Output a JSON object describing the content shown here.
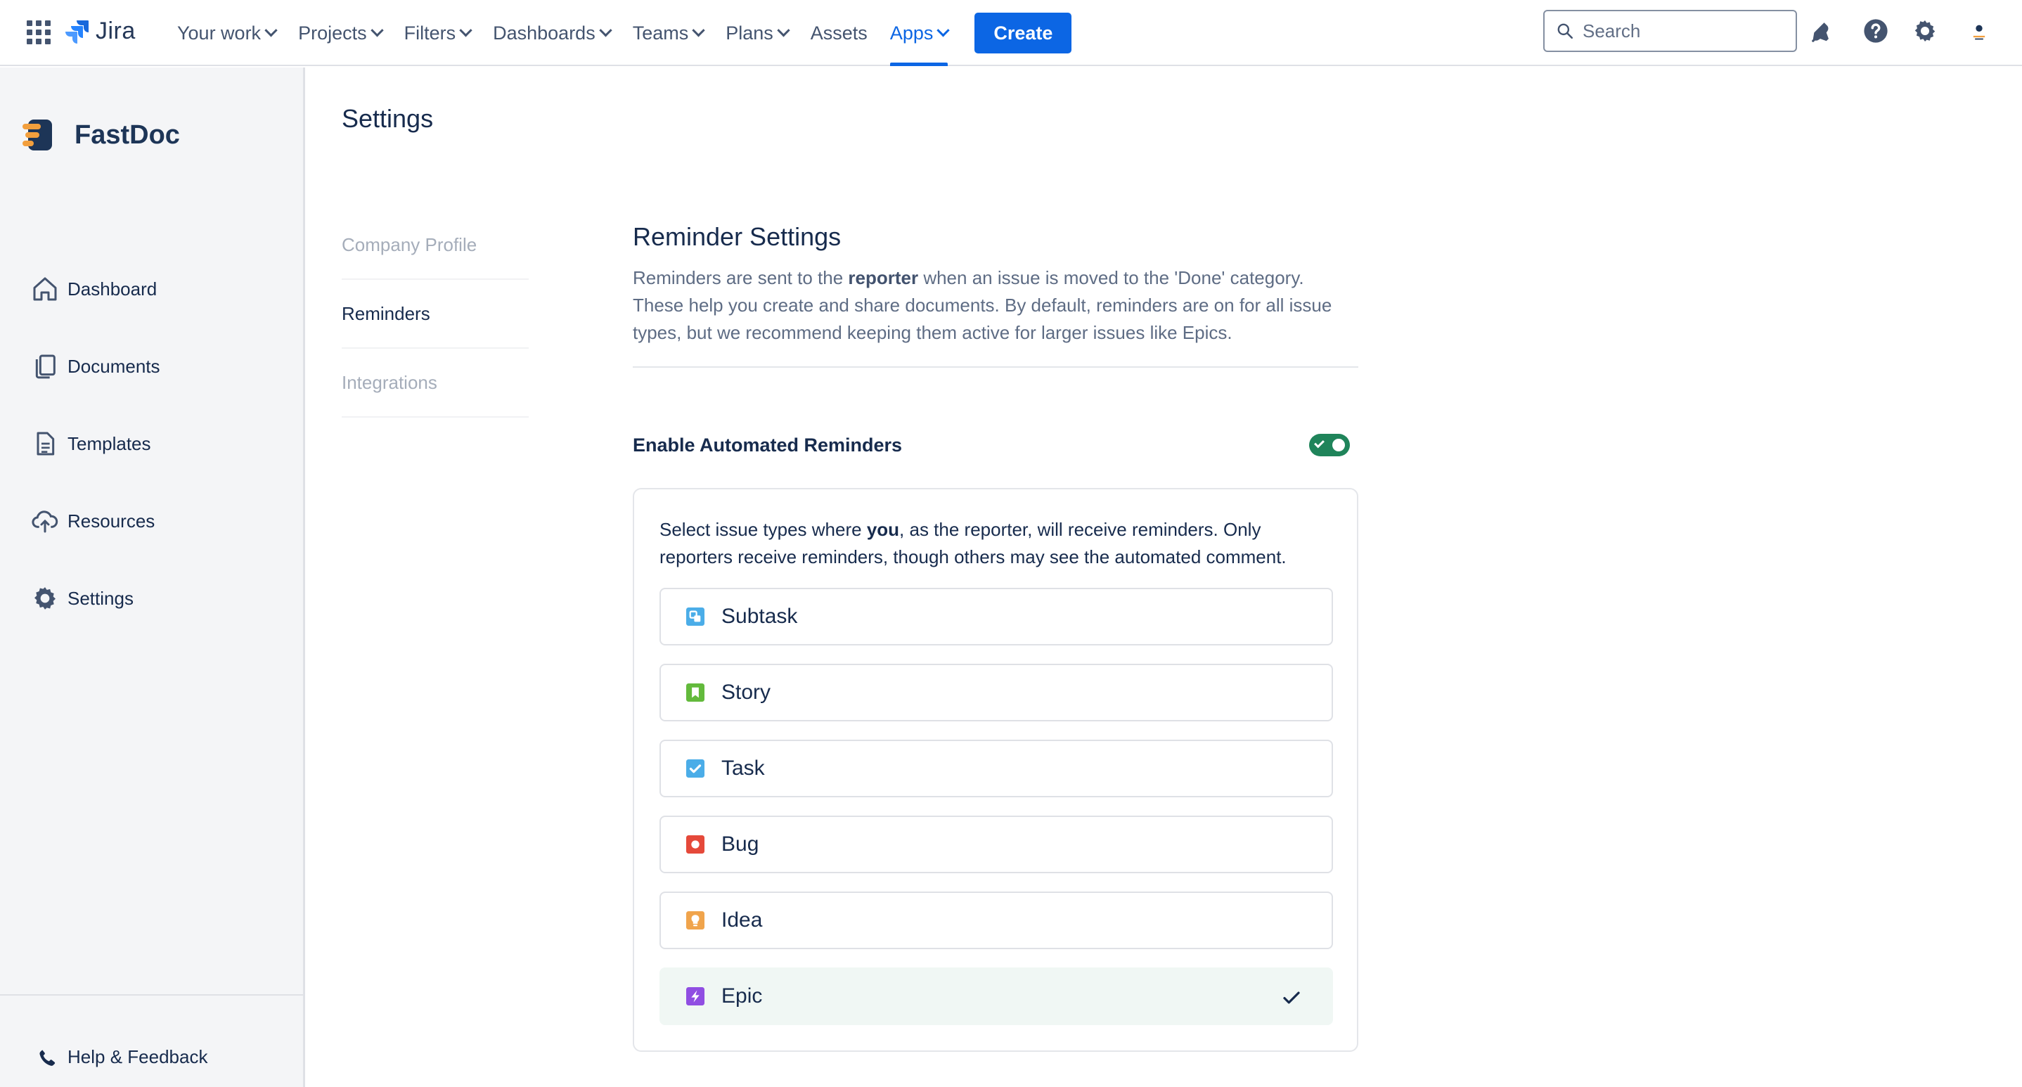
{
  "topnav": {
    "logo_text": "Jira",
    "menu": [
      {
        "label": "Your work",
        "has_dropdown": true
      },
      {
        "label": "Projects",
        "has_dropdown": true
      },
      {
        "label": "Filters",
        "has_dropdown": true
      },
      {
        "label": "Dashboards",
        "has_dropdown": true
      },
      {
        "label": "Teams",
        "has_dropdown": true
      },
      {
        "label": "Plans",
        "has_dropdown": true
      },
      {
        "label": "Assets",
        "has_dropdown": false
      },
      {
        "label": "Apps",
        "has_dropdown": true,
        "active": true
      }
    ],
    "create_label": "Create",
    "search_placeholder": "Search",
    "icons": [
      "app-switcher-icon",
      "notifications-icon",
      "help-icon",
      "settings-icon",
      "profile-avatar"
    ]
  },
  "sidebar": {
    "brand": "FastDoc",
    "items": [
      {
        "label": "Dashboard",
        "icon": "home-icon"
      },
      {
        "label": "Documents",
        "icon": "documents-icon"
      },
      {
        "label": "Templates",
        "icon": "template-icon"
      },
      {
        "label": "Resources",
        "icon": "cloud-upload-icon"
      },
      {
        "label": "Settings",
        "icon": "gear-icon"
      }
    ],
    "help_label": "Help & Feedback"
  },
  "page": {
    "title": "Settings",
    "subnav": [
      {
        "label": "Company Profile",
        "active": false
      },
      {
        "label": "Reminders",
        "active": true
      },
      {
        "label": "Integrations",
        "active": false
      }
    ]
  },
  "reminders": {
    "heading": "Reminder Settings",
    "desc_before": "Reminders are sent to the ",
    "desc_bold": "reporter",
    "desc_after": " when an issue is moved to the 'Done' category. These help you create and share documents. By default, reminders are on for all issue types, but we recommend keeping them active for larger issues like Epics.",
    "toggle_label": "Enable Automated Reminders",
    "toggle_on": true,
    "intro_before": "Select issue types where ",
    "intro_bold": "you",
    "intro_after": ", as the reporter, will receive reminders. Only reporters receive reminders, though others may see the automated comment.",
    "issue_types": [
      {
        "label": "Subtask",
        "icon": "subtask-icon",
        "color": "#4bade8",
        "selected": false
      },
      {
        "label": "Story",
        "icon": "story-icon",
        "color": "#63ba3c",
        "selected": false
      },
      {
        "label": "Task",
        "icon": "task-icon",
        "color": "#4bade8",
        "selected": false
      },
      {
        "label": "Bug",
        "icon": "bug-icon",
        "color": "#e5493a",
        "selected": false
      },
      {
        "label": "Idea",
        "icon": "idea-icon",
        "color": "#f0a44c",
        "selected": false
      },
      {
        "label": "Epic",
        "icon": "epic-icon",
        "color": "#904ee2",
        "selected": true
      }
    ]
  },
  "colors": {
    "accent": "#0c66e4",
    "toggle_on": "#1f845a",
    "selected_row": "#f0f7f4",
    "brand_orange": "#f29f3d",
    "brand_navy": "#1d3557"
  }
}
